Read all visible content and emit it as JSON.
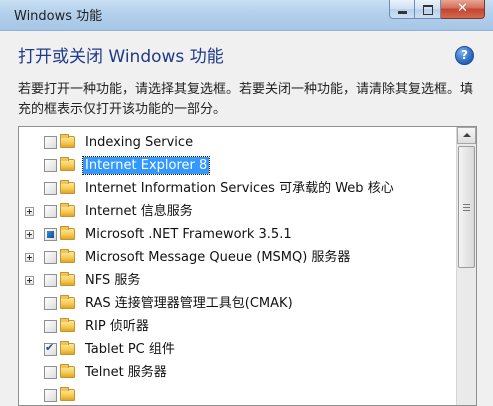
{
  "window": {
    "title": "Windows 功能",
    "caption": {
      "minimize": "",
      "maximize": "",
      "close": "✕"
    }
  },
  "header": {
    "title": "打开或关闭 Windows 功能",
    "help_icon": "help-icon",
    "help_glyph": "?"
  },
  "description": "若要打开一种功能，请选择其复选框。若要关闭一种功能，请清除其复选框。填充的框表示仅打开该功能的一部分。",
  "features": [
    {
      "label": "Indexing Service",
      "expandable": false,
      "state": "unchecked",
      "selected": false
    },
    {
      "label": "Internet Explorer 8",
      "expandable": false,
      "state": "unchecked",
      "selected": true
    },
    {
      "label": "Internet Information Services 可承载的 Web 核心",
      "expandable": false,
      "state": "unchecked",
      "selected": false
    },
    {
      "label": "Internet 信息服务",
      "expandable": true,
      "state": "unchecked",
      "selected": false
    },
    {
      "label": "Microsoft .NET Framework 3.5.1",
      "expandable": true,
      "state": "partial",
      "selected": false
    },
    {
      "label": "Microsoft Message Queue (MSMQ) 服务器",
      "expandable": true,
      "state": "unchecked",
      "selected": false
    },
    {
      "label": "NFS 服务",
      "expandable": true,
      "state": "unchecked",
      "selected": false
    },
    {
      "label": "RAS 连接管理器管理工具包(CMAK)",
      "expandable": false,
      "state": "unchecked",
      "selected": false
    },
    {
      "label": "RIP 侦听器",
      "expandable": false,
      "state": "unchecked",
      "selected": false
    },
    {
      "label": "Tablet PC 组件",
      "expandable": false,
      "state": "checked",
      "selected": false
    },
    {
      "label": "Telnet 服务器",
      "expandable": false,
      "state": "unchecked",
      "selected": false
    },
    {
      "label": "",
      "expandable": false,
      "state": "unchecked",
      "selected": false
    }
  ],
  "colors": {
    "header_blue": "#1e3a8a",
    "selection_blue": "#3399ff",
    "partial_fill": "#12508f"
  }
}
